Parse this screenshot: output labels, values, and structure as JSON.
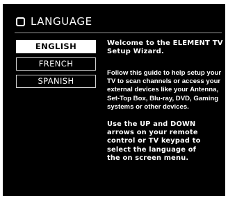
{
  "header": {
    "icon": "square-outline-icon",
    "title": "LANGUAGE"
  },
  "languages": [
    {
      "label": "ENGLISH",
      "selected": true
    },
    {
      "label": "FRENCH",
      "selected": false
    },
    {
      "label": "SPANISH",
      "selected": false
    }
  ],
  "info": {
    "welcome_lines": [
      "Welcome to the ELEMENT TV",
      "Setup Wizard."
    ],
    "guide_lines": [
      "Follow this guide to help setup your",
      "TV to scan channels or access your",
      "external devices like your Antenna,",
      "Set-Top Box, Blu-ray, DVD, Gaming",
      "systems or other  devices."
    ],
    "instruction_lines": [
      "Use the UP and DOWN",
      "arrows on your remote",
      "control or TV keypad to",
      "select the language of",
      "the on screen menu."
    ]
  },
  "colors": {
    "background": "#000000",
    "text": "#ffffff",
    "selected_bg": "#ffffff",
    "selected_text": "#000000",
    "border": "#cfcfcf"
  }
}
